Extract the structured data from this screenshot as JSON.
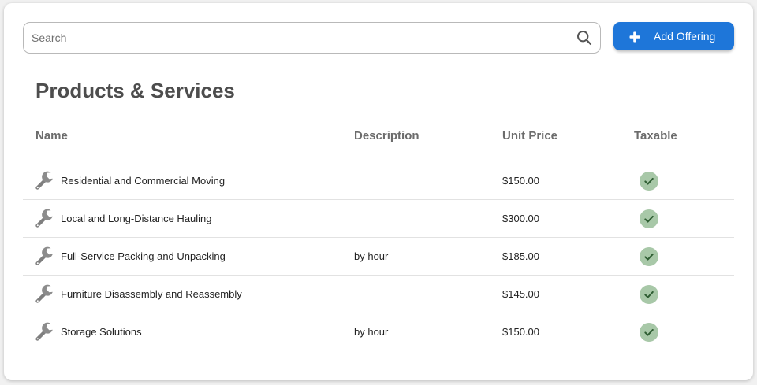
{
  "search": {
    "placeholder": "Search",
    "value": ""
  },
  "toolbar": {
    "add_label": "Add Offering"
  },
  "page": {
    "title": "Products & Services"
  },
  "table": {
    "columns": {
      "name": "Name",
      "description": "Description",
      "unit_price": "Unit Price",
      "taxable": "Taxable"
    },
    "rows": [
      {
        "name": "Residential and Commercial Moving",
        "description": "",
        "unit_price": "$150.00",
        "taxable": true
      },
      {
        "name": "Local and Long-Distance Hauling",
        "description": "",
        "unit_price": "$300.00",
        "taxable": true
      },
      {
        "name": "Full-Service Packing and Unpacking",
        "description": "by hour",
        "unit_price": "$185.00",
        "taxable": true
      },
      {
        "name": "Furniture Disassembly and Reassembly",
        "description": "",
        "unit_price": "$145.00",
        "taxable": true
      },
      {
        "name": "Storage Solutions",
        "description": "by hour",
        "unit_price": "$150.00",
        "taxable": true
      }
    ]
  },
  "icons": {
    "search": "search-icon",
    "add": "plus-icon",
    "row": "wrench-icon",
    "taxable": "check-circle-icon"
  },
  "colors": {
    "accent": "#1e76d9",
    "check_bg": "#a8c8a8",
    "check_mark": "#2f5e33",
    "title": "#4d4d4d"
  }
}
